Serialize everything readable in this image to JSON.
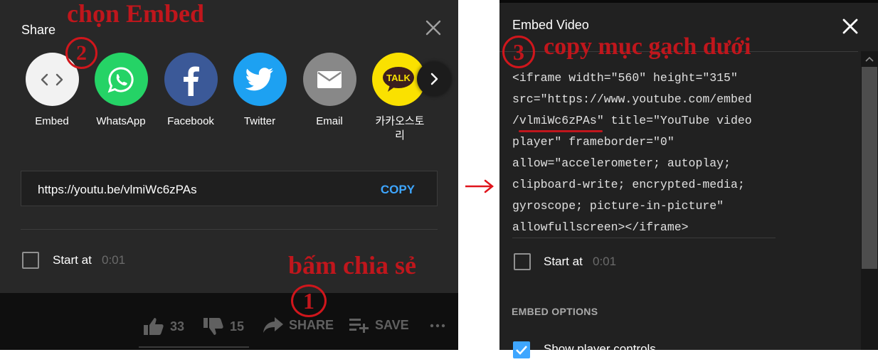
{
  "share_dialog": {
    "title": "Share",
    "apps": [
      {
        "label": "Embed",
        "icon": "embed-code-icon"
      },
      {
        "label": "WhatsApp",
        "icon": "whatsapp-icon"
      },
      {
        "label": "Facebook",
        "icon": "facebook-icon"
      },
      {
        "label": "Twitter",
        "icon": "twitter-icon"
      },
      {
        "label": "Email",
        "icon": "email-icon"
      },
      {
        "label": "카카오스토리",
        "icon": "kakao-talk-icon",
        "badge": "TALK"
      }
    ],
    "url": "https://youtu.be/vlmiWc6zPAs",
    "copy_label": "COPY",
    "start_at_label": "Start at",
    "start_at_time": "0:01"
  },
  "action_bar": {
    "like_count": "33",
    "dislike_count": "15",
    "share_label": "SHARE",
    "save_label": "SAVE"
  },
  "embed_dialog": {
    "title": "Embed Video",
    "code_lines": [
      "<iframe width=\"560\" height=\"315\"",
      "src=\"https://www.youtube.com/embed",
      "/vlmiWc6zPAs\" title=\"YouTube video",
      "player\" frameborder=\"0\"",
      "allow=\"accelerometer; autoplay;",
      "clipboard-write; encrypted-media;",
      "gyroscope; picture-in-picture\"",
      "allowfullscreen></iframe>"
    ],
    "start_at_label": "Start at",
    "start_at_time": "0:01",
    "embed_options_heading": "EMBED OPTIONS",
    "show_controls_label": "Show player controls"
  },
  "annotations": {
    "step1_text": "bấm chia sẻ",
    "step1_num": "1",
    "step2_text": "chọn Embed",
    "step2_num": "2",
    "step3_text": "copy mục gạch dưới",
    "step3_num": "3"
  },
  "colors": {
    "annotation_red": "#c0161c",
    "link_blue": "#3ea6ff",
    "whatsapp_green": "#25d366",
    "facebook_blue": "#3b5998",
    "twitter_blue": "#1da1f2",
    "kakao_yellow": "#fae100"
  }
}
